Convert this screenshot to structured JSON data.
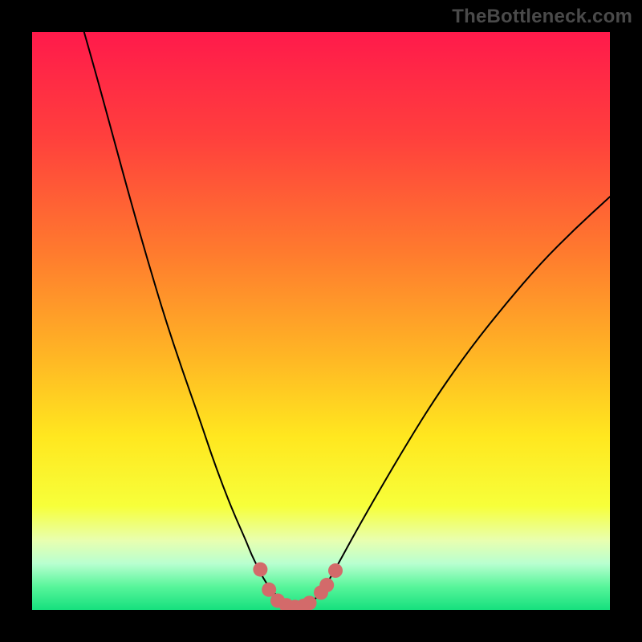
{
  "watermark": "TheBottleneck.com",
  "chart_data": {
    "type": "line",
    "title": "",
    "xlabel": "",
    "ylabel": "",
    "xlim": [
      0,
      100
    ],
    "ylim": [
      0,
      100
    ],
    "grid": false,
    "legend": false,
    "background_gradient_stops": [
      {
        "offset": 0.0,
        "color": "#ff1a4b"
      },
      {
        "offset": 0.18,
        "color": "#ff3f3d"
      },
      {
        "offset": 0.38,
        "color": "#ff7a2e"
      },
      {
        "offset": 0.55,
        "color": "#ffb225"
      },
      {
        "offset": 0.7,
        "color": "#ffe71f"
      },
      {
        "offset": 0.82,
        "color": "#f7ff3a"
      },
      {
        "offset": 0.88,
        "color": "#e8ffb0"
      },
      {
        "offset": 0.92,
        "color": "#b8ffd0"
      },
      {
        "offset": 0.96,
        "color": "#57f59a"
      },
      {
        "offset": 1.0,
        "color": "#16e07e"
      }
    ],
    "series": [
      {
        "name": "curve",
        "stroke": "#000000",
        "stroke_width": 2,
        "points": [
          {
            "x": 9.0,
            "y": 100.0
          },
          {
            "x": 11.0,
            "y": 93.0
          },
          {
            "x": 14.0,
            "y": 82.0
          },
          {
            "x": 17.0,
            "y": 71.0
          },
          {
            "x": 20.0,
            "y": 60.5
          },
          {
            "x": 23.0,
            "y": 50.5
          },
          {
            "x": 26.0,
            "y": 41.5
          },
          {
            "x": 29.0,
            "y": 33.0
          },
          {
            "x": 31.0,
            "y": 27.0
          },
          {
            "x": 33.0,
            "y": 21.5
          },
          {
            "x": 35.0,
            "y": 16.5
          },
          {
            "x": 37.0,
            "y": 12.0
          },
          {
            "x": 38.0,
            "y": 9.5
          },
          {
            "x": 39.0,
            "y": 7.5
          },
          {
            "x": 40.0,
            "y": 5.5
          },
          {
            "x": 41.0,
            "y": 4.0
          },
          {
            "x": 42.0,
            "y": 2.8
          },
          {
            "x": 43.0,
            "y": 1.8
          },
          {
            "x": 44.0,
            "y": 1.1
          },
          {
            "x": 45.0,
            "y": 0.6
          },
          {
            "x": 46.0,
            "y": 0.4
          },
          {
            "x": 47.0,
            "y": 0.6
          },
          {
            "x": 48.0,
            "y": 1.1
          },
          {
            "x": 49.0,
            "y": 1.9
          },
          {
            "x": 50.0,
            "y": 3.0
          },
          {
            "x": 51.0,
            "y": 4.5
          },
          {
            "x": 53.0,
            "y": 8.0
          },
          {
            "x": 56.0,
            "y": 13.5
          },
          {
            "x": 60.0,
            "y": 20.5
          },
          {
            "x": 65.0,
            "y": 29.0
          },
          {
            "x": 70.0,
            "y": 37.0
          },
          {
            "x": 76.0,
            "y": 45.5
          },
          {
            "x": 82.0,
            "y": 53.0
          },
          {
            "x": 88.0,
            "y": 60.0
          },
          {
            "x": 94.0,
            "y": 66.0
          },
          {
            "x": 100.0,
            "y": 71.5
          }
        ]
      }
    ],
    "markers": {
      "name": "highlight-dots",
      "fill": "#d36a6a",
      "radius": 9,
      "points": [
        {
          "x": 39.5,
          "y": 7.0
        },
        {
          "x": 41.0,
          "y": 3.5
        },
        {
          "x": 42.5,
          "y": 1.6
        },
        {
          "x": 44.0,
          "y": 0.8
        },
        {
          "x": 45.5,
          "y": 0.5
        },
        {
          "x": 47.0,
          "y": 0.7
        },
        {
          "x": 48.0,
          "y": 1.2
        },
        {
          "x": 50.0,
          "y": 3.0
        },
        {
          "x": 51.0,
          "y": 4.3
        },
        {
          "x": 52.5,
          "y": 6.8
        }
      ]
    }
  }
}
